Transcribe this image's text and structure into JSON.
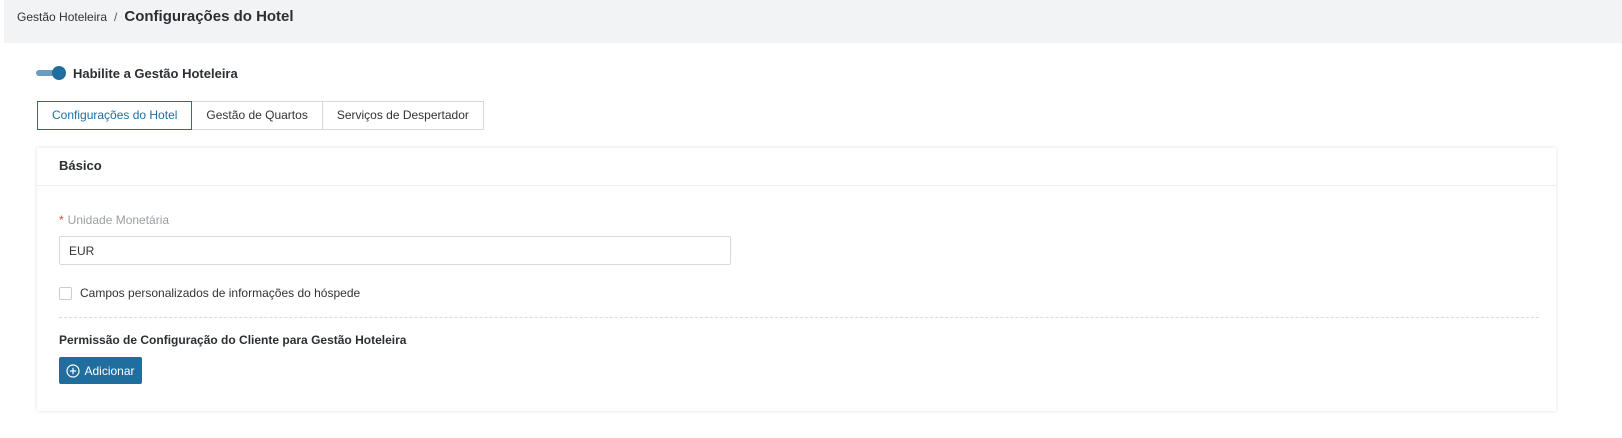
{
  "breadcrumb": {
    "parent": "Gestão Hoteleira",
    "separator": "/",
    "current": "Configurações do Hotel"
  },
  "toggle": {
    "label": "Habilite a Gestão Hoteleira",
    "enabled": true
  },
  "tabs": [
    {
      "label": "Configurações do Hotel",
      "active": true
    },
    {
      "label": "Gestão de Quartos",
      "active": false
    },
    {
      "label": "Serviços de Despertador",
      "active": false
    }
  ],
  "basic": {
    "title": "Básico",
    "currency": {
      "required_mark": "*",
      "label": "Unidade Monetária",
      "value": "EUR"
    },
    "custom_fields": {
      "label": "Campos personalizados de informações do hóspede",
      "checked": false
    },
    "permission": {
      "title": "Permissão de Configuração do Cliente para Gestão Hoteleira",
      "add_label": "Adicionar",
      "add_icon": "plus-circle-icon"
    }
  },
  "colors": {
    "accent": "#1f6e9e",
    "required": "#e0453a",
    "background": "#f2f3f5"
  }
}
